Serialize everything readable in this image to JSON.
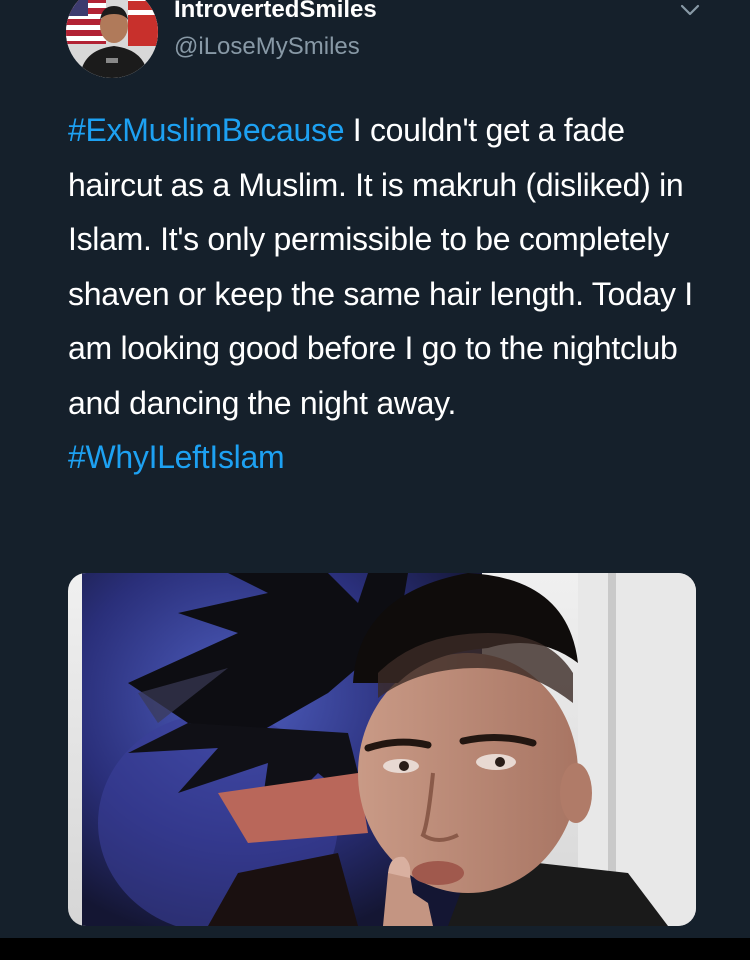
{
  "tweet": {
    "display_name": "IntrovertedSmiles",
    "handle": "@iLoseMySmiles",
    "hashtag_start": "#ExMuslimBecause",
    "body": " I couldn't get a fade haircut as a Muslim. It is makruh (disliked) in Islam. It's only permissible to be completely shaven or keep the same hair length. Today I am looking good before I go to the nightclub and dancing the night away.",
    "hashtag_end": "#WhyILeftIslam"
  },
  "icons": {
    "menu": "chevron-down-icon"
  },
  "colors": {
    "background": "#15202b",
    "text": "#ffffff",
    "secondary_text": "#8899a6",
    "link": "#1da1f2"
  }
}
